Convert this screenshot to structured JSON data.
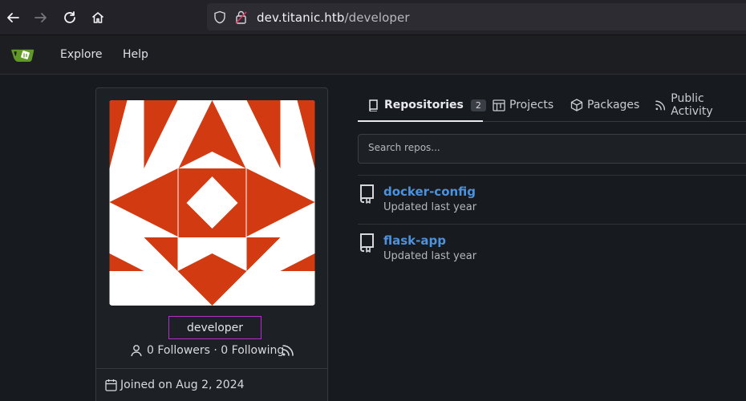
{
  "browser": {
    "url_host": "dev.titanic.htb",
    "url_path": "/developer"
  },
  "nav": {
    "explore": "Explore",
    "help": "Help"
  },
  "profile": {
    "username": "developer",
    "followers": "0 Followers",
    "separator": " · ",
    "following": "0 Following",
    "joined": "Joined on Aug 2, 2024"
  },
  "tabs": {
    "repositories": "Repositories",
    "repositories_count": "2",
    "projects": "Projects",
    "packages": "Packages",
    "public_activity": "Public Activity"
  },
  "search": {
    "placeholder": "Search repos..."
  },
  "repos": [
    {
      "name": "docker-config",
      "meta": "Updated last year"
    },
    {
      "name": "flask-app",
      "meta": "Updated last year"
    }
  ],
  "colors": {
    "avatar_red": "#d23a12",
    "link_blue": "#4d92dc",
    "username_border": "#b62fcc",
    "gitea_green": "#609926"
  }
}
